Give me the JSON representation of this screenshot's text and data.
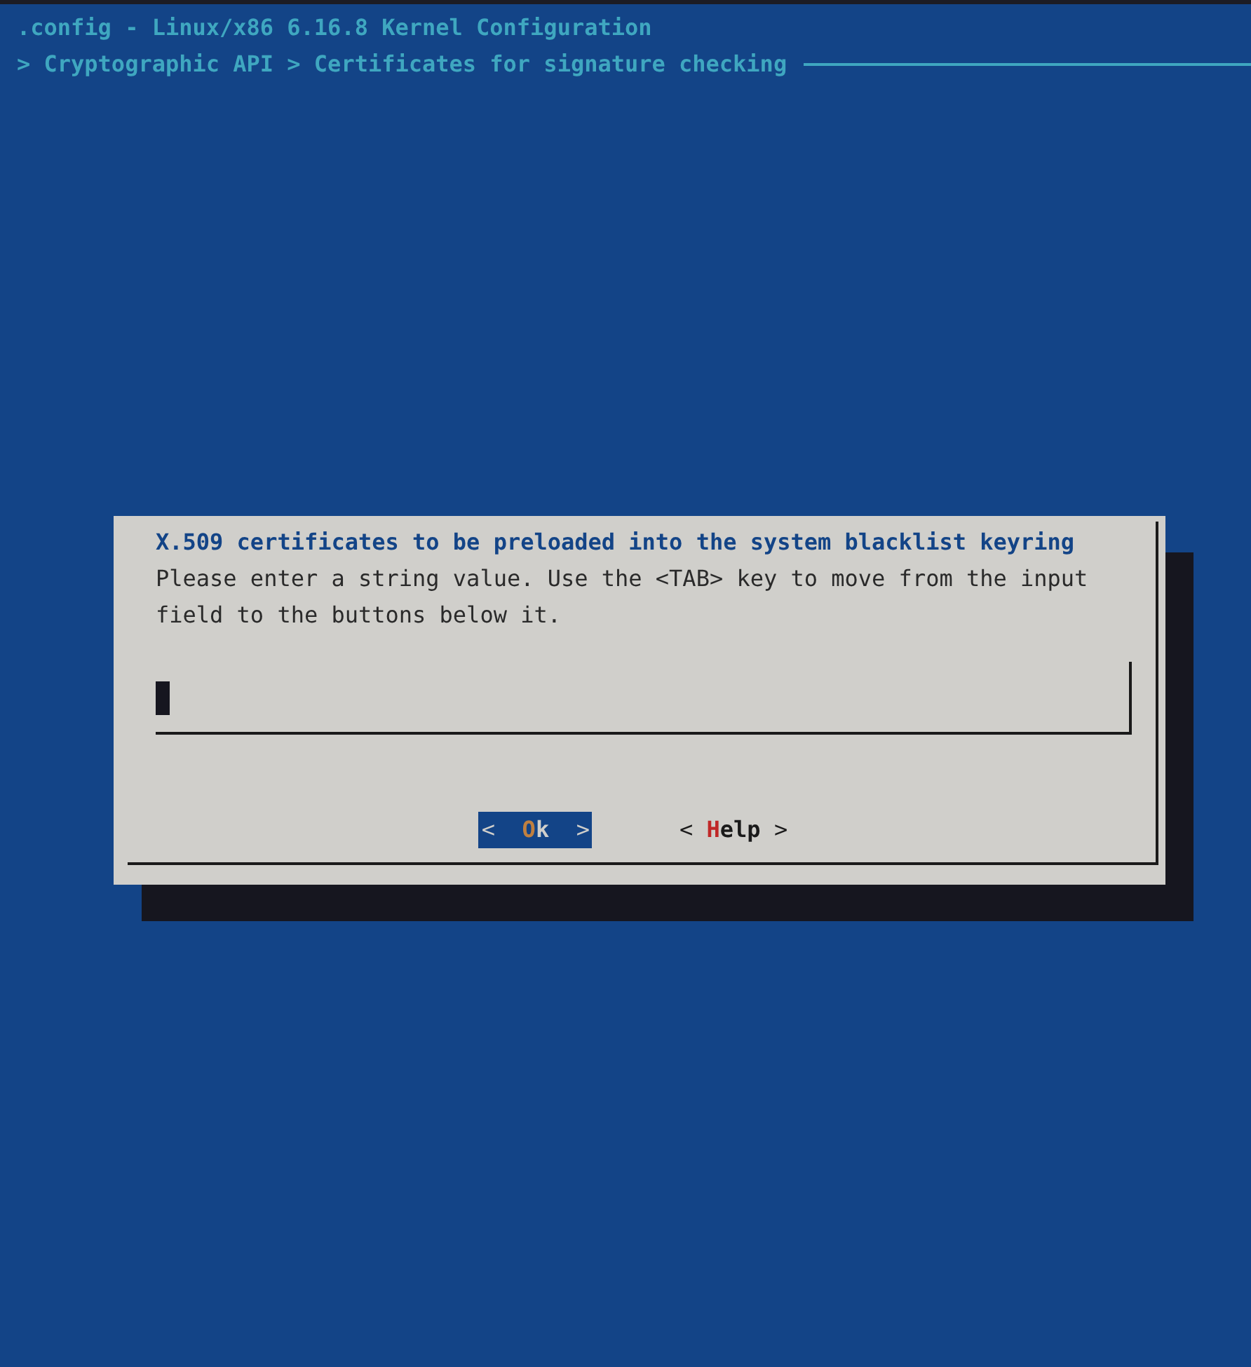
{
  "window": {
    "title": ".config - Linux/x86 6.16.8 Kernel Configuration"
  },
  "breadcrumb": "> Cryptographic API > Certificates for signature checking",
  "dialog": {
    "title": "X.509 certificates to be preloaded into the system blacklist keyring",
    "message": "Please enter a string value. Use the <TAB> key to move from the input field to the buttons below it.",
    "buttons": [
      {
        "open": "<",
        "hotkey": "O",
        "rest": "k",
        "close": ">",
        "selected": true
      },
      {
        "open": "<",
        "hotkey": "H",
        "rest": "elp",
        "close": ">",
        "selected": false
      }
    ]
  }
}
